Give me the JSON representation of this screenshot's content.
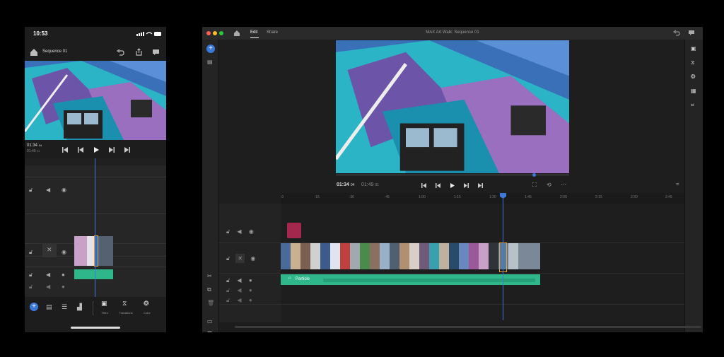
{
  "phone": {
    "status_time": "10:53",
    "project_title": "Sequence 01",
    "timecode_current": "01:34",
    "timecode_current_frames": "04",
    "timecode_total": "01:49",
    "timecode_total_frames": "01",
    "bottom_labels": [
      "Titles",
      "Transitions",
      "Color"
    ]
  },
  "desktop": {
    "tabs": [
      "Edit",
      "Share"
    ],
    "active_tab": "Edit",
    "window_title": "MAX Art Walk: Sequence 01",
    "timecode_current": "01:34",
    "timecode_current_frames": "04",
    "timecode_total": "01:49",
    "timecode_total_frames": "01",
    "ruler_ticks": [
      ":0",
      ":15",
      ":30",
      ":45",
      "1:00",
      "1:15",
      "1:30",
      "1:45",
      "2:00",
      "2:15",
      "2:30",
      "2:45"
    ],
    "audio_clip_label": "Particle",
    "colors": {
      "accent_blue": "#3c78d8",
      "audio_green": "#2fb68a",
      "clip_selected": "#f0a020",
      "title_clip": "#a4284e",
      "traffic_red": "#fe5f57",
      "traffic_yellow": "#febc2e",
      "traffic_green": "#28c840"
    }
  }
}
